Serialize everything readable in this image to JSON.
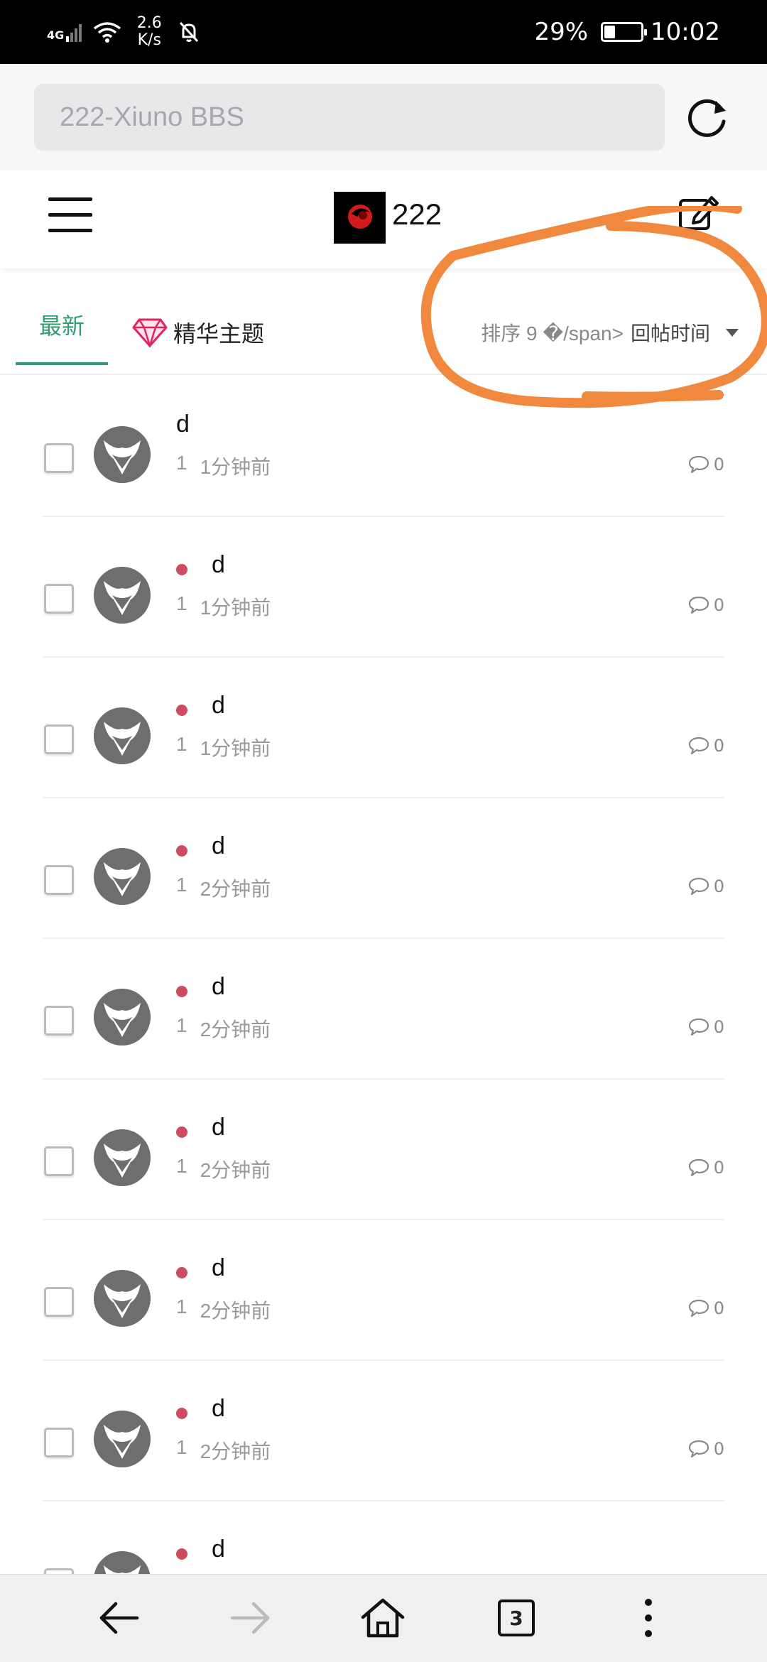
{
  "status_bar": {
    "network": "4G",
    "speed_value": "2.6",
    "speed_unit": "K/s",
    "battery_percent": "29%",
    "battery_level": 0.29,
    "time": "10:02"
  },
  "browser": {
    "url_text": "222-Xiuno BBS",
    "tab_count": "3"
  },
  "header": {
    "site_name": "222"
  },
  "tabs": {
    "latest": "最新",
    "digest": "精华主题",
    "sort_label": "排序 9 �/span>",
    "sort_value": "回帖时间"
  },
  "threads": [
    {
      "title": "d",
      "author": "1",
      "time": "1分钟前",
      "replies": "0",
      "is_new": false
    },
    {
      "title": "d",
      "author": "1",
      "time": "1分钟前",
      "replies": "0",
      "is_new": true
    },
    {
      "title": "d",
      "author": "1",
      "time": "1分钟前",
      "replies": "0",
      "is_new": true
    },
    {
      "title": "d",
      "author": "1",
      "time": "2分钟前",
      "replies": "0",
      "is_new": true
    },
    {
      "title": "d",
      "author": "1",
      "time": "2分钟前",
      "replies": "0",
      "is_new": true
    },
    {
      "title": "d",
      "author": "1",
      "time": "2分钟前",
      "replies": "0",
      "is_new": true
    },
    {
      "title": "d",
      "author": "1",
      "time": "2分钟前",
      "replies": "0",
      "is_new": true
    },
    {
      "title": "d",
      "author": "1",
      "time": "2分钟前",
      "replies": "0",
      "is_new": true
    },
    {
      "title": "d",
      "author": "",
      "time": "",
      "replies": "",
      "is_new": true
    }
  ],
  "colors": {
    "accent": "#2f9e6e",
    "new_dot": "#cc4b5c",
    "annotation": "#f0883e"
  },
  "icons": {
    "reload": "reload-icon",
    "menu": "hamburger-menu-icon",
    "edit": "compose-icon",
    "digest": "diamond-icon",
    "replies": "comment-icon",
    "back": "back-arrow-icon",
    "forward": "forward-arrow-icon",
    "home": "home-icon",
    "more": "more-vertical-icon"
  }
}
